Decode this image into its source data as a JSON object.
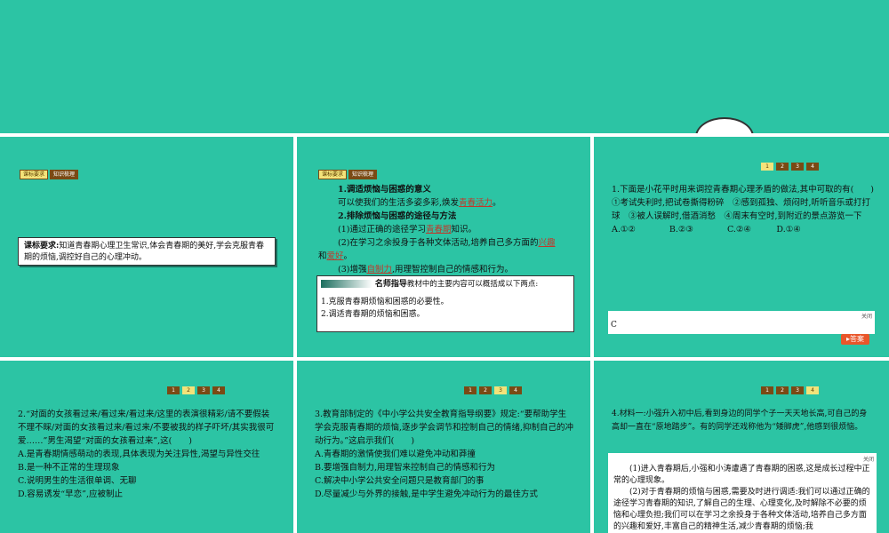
{
  "tags": {
    "t1": "课标要求",
    "t2": "知识梳理"
  },
  "slide1": {
    "label": "课标要求:",
    "text": "知道青春期心理卫生常识,体会青春期的美好,学会克服青春期的烦恼,调控好自己的心理冲动。"
  },
  "slide2": {
    "p1": "1.调适烦恼与困惑的意义",
    "p2a": "可以使我们的生活多姿多彩,焕发",
    "p2b": "青春活力",
    "p2c": "。",
    "p3": "2.排除烦恼与困惑的途径与方法",
    "p4a": "(1)通过正确的途径学习",
    "p4b": "青春期",
    "p4c": "知识。",
    "p5a": "(2)在学习之余投身于各种文体活动,培养自己多方面的",
    "p5b": "兴趣",
    "p5c": "和",
    "p5d": "爱好",
    "p5e": "。",
    "p6a": "(3)增强",
    "p6b": "自制力",
    "p6c": ",用理智控制自己的情感和行为。",
    "tip_title": "名师指导",
    "tip_intro": "教材中的主要内容可以概括成以下两点:",
    "tip1": "1.克服青春期烦恼和困惑的必要性。",
    "tip2": "2.调适青春期的烦恼和困惑。"
  },
  "pager": [
    "1",
    "2",
    "3",
    "4"
  ],
  "slide3": {
    "q": "1.下面是小花平时用来调控青春期心理矛盾的做法,其中可取的有(　　)",
    "o1": "①考试失利时,把试卷撕得粉碎　②感到孤独、烦闷时,听听音乐或打打球　③被人误解时,借酒消愁　④周末有空时,到附近的景点游览一下",
    "opts": "A.①②　　　　B.②③　　　　C.②④　　　D.①④",
    "close": "关闭",
    "answer": "C",
    "ans_btn": "答案"
  },
  "slide4": {
    "q": "2.“对面的女孩看过来/看过来/看过来/这里的表演很精彩/请不要假装不理不睬/对面的女孩看过来/看过来/不要被我的样子吓坏/其实我很可爱……”男生渴望“对面的女孩看过来”,这(　　)",
    "a": "A.是青春期情感萌动的表现,具体表现为关注异性,渴望与异性交往",
    "b": "B.是一种不正常的生理现象",
    "c": "C.说明男生的生活很单调、无聊",
    "d": "D.容易诱发“早恋”,应被制止"
  },
  "slide5": {
    "q": "3.教育部制定的《中小学公共安全教育指导纲要》规定:“要帮助学生学会克服青春期的烦恼,逐步学会调节和控制自己的情绪,抑制自己的冲动行为。”这启示我们(　　)",
    "a": "A.青春期的激情使我们难以避免冲动和莽撞",
    "b": "B.要增强自制力,用理智来控制自己的情感和行为",
    "c": "C.解决中小学公共安全问题只是教育部门的事",
    "d": "D.尽量减少与外界的接触,是中学生避免冲动行为的最佳方式"
  },
  "slide6": {
    "q": "4.材料一:小强升入初中后,看到身边的同学个子一天天地长高,可自己的身高却一直在“原地踏步”。有的同学还戏称他为“矮脚虎”,他感到很烦恼。",
    "close": "关闭",
    "a1": "(1)进入青春期后,小强和小涛遭遇了青春期的困惑,这是成长过程中正常的心理现象。",
    "a2": "(2)对于青春期的烦恼与困惑,需要及时进行调适:我们可以通过正确的途径学习青春期的知识,了解自己的生理、心理变化,及时解除不必要的烦恼和心理负担;我们可以在学习之余投身于各种文体活动,培养自己多方面的兴趣和爱好,丰富自己的精神生活,减少青春期的烦恼;我"
  }
}
